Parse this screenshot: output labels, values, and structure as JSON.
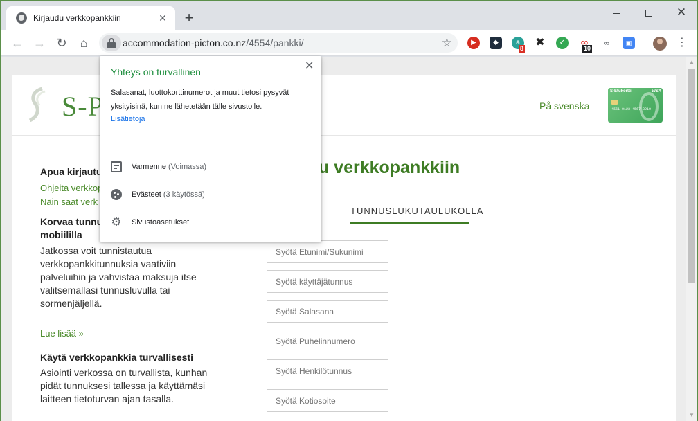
{
  "browser": {
    "tab_title": "Kirjaudu verkkopankkiin",
    "url_host": "accommodation-picton.co.nz",
    "url_path": "/4554/pankki/",
    "extensions": [
      {
        "name": "youtube-ext-icon",
        "color": "#d62d20"
      },
      {
        "name": "dark-square-ext-icon",
        "color": "#1f2d3d"
      },
      {
        "name": "a-ext-icon",
        "color": "#2aa198",
        "badge": "8"
      },
      {
        "name": "cross-ext-icon",
        "color": "#222222"
      },
      {
        "name": "shield-ext-icon",
        "color": "#34a853"
      },
      {
        "name": "link-ext-icon",
        "color": "#e53935",
        "badge": "10"
      },
      {
        "name": "infinity-ext-icon",
        "color": "#5f6368"
      },
      {
        "name": "blue-box-ext-icon",
        "color": "#4285f4"
      }
    ]
  },
  "popup": {
    "title": "Yhteys on turvallinen",
    "description": "Salasanat, luottokorttinumerot ja muut tietosi pysyvät yksityisinä, kun ne lähetetään tälle sivustolle.",
    "link": "Lisätietoja",
    "rows": [
      {
        "label": "Varmenne",
        "detail": "(Voimassa)"
      },
      {
        "label": "Evästeet",
        "detail": "(3 käytössä)"
      },
      {
        "label": "Sivustoasetukset",
        "detail": ""
      }
    ]
  },
  "page": {
    "logo_text": "S-P",
    "language_link": "På svenska",
    "card": {
      "title": "S-Etukortti",
      "visa": "VISA",
      "number": "4561 0123 4567 8910"
    },
    "left": {
      "help_heading": "Apua kirjautu",
      "help_link_1": "Ohjeita verkkop",
      "help_link_2": "Näin saat verk",
      "replace_heading_1": "Korvaa tunnus",
      "replace_heading_2": "mobiililla",
      "replace_text": "Jatkossa voit tunnistautua verkkopankkitunnuksia vaativiin palveluihin ja vahvistaa maksuja itse valitsemallasi tunnusluvulla tai sormenjäljellä.",
      "read_more": "Lue lisää »",
      "safe_heading": "Käytä verkkopankkia turvallisesti",
      "safe_text": "Asiointi verkossa on turvallista, kunhan pidät tunnuksesi tallessa ja käyttämäsi laitteen tietoturvan ajan tasalla."
    },
    "main_title": "lu verkkopankkiin",
    "tab_partial": "A",
    "tab_active": "TUNNUSLUKUTAULUKOLLA",
    "fields": [
      "Syötä Etunimi/Sukunimi",
      "Syötä käyttäjätunnus",
      "Syötä Salasana",
      "Syötä Puhelinnumero",
      "Syötä Henkilötunnus",
      "Syötä Kotiosoite"
    ]
  },
  "colors": {
    "brand_green": "#3e7c24",
    "secure_green": "#1e8e3e",
    "link_blue": "#1a73e8"
  }
}
